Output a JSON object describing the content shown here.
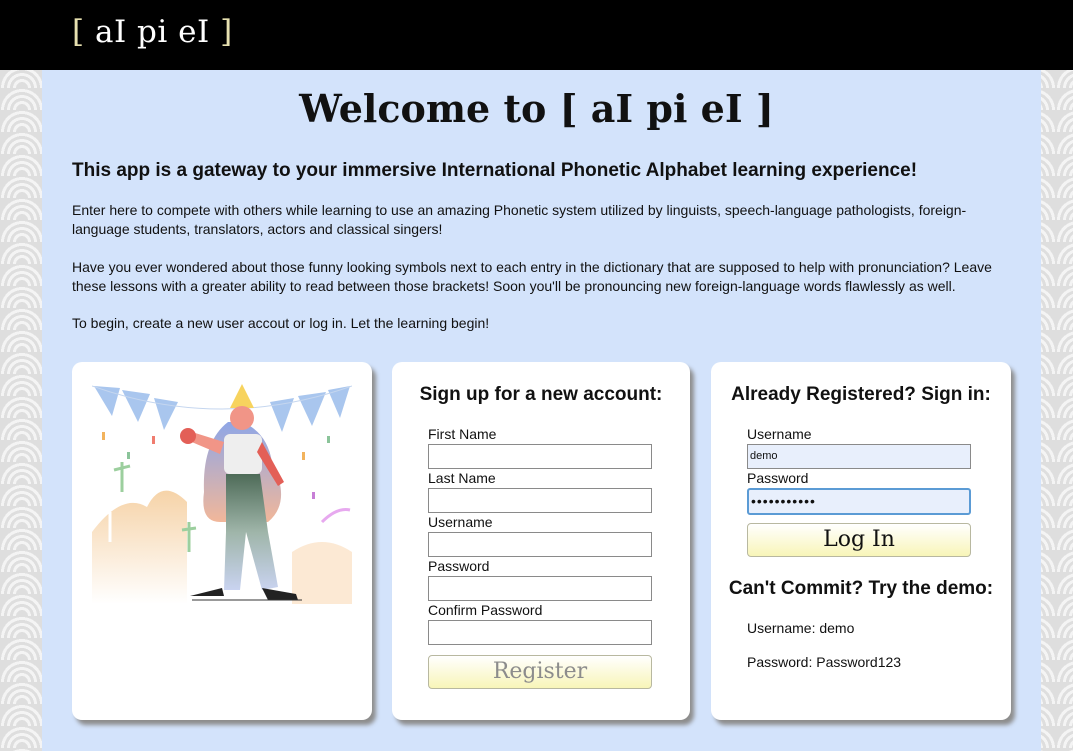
{
  "header": {
    "logo_open": "[",
    "logo_text": " aI pi eI ",
    "logo_close": "]"
  },
  "welcome": {
    "title": "Welcome to [ aI pi eI ]"
  },
  "intro": {
    "heading": "This app is a gateway to your immersive International Phonetic Alphabet learning experience!",
    "p1": "Enter here to compete with others while learning to use an amazing Phonetic system utilized by linguists, speech-language pathologists, foreign-language students, translators, actors and classical singers!",
    "p2": "Have you ever wondered about those funny looking symbols next to each entry in the dictionary that are supposed to help with pronunciation? Leave these lessons with a greater ability to read between those brackets! Soon you'll be pronouncing new foreign-language words flawlessly as well.",
    "p3": "To begin, create a new user accout or log in. Let the learning begin!"
  },
  "signup": {
    "title": "Sign up for a new account:",
    "first_name_label": "First Name",
    "last_name_label": "Last Name",
    "username_label": "Username",
    "password_label": "Password",
    "confirm_label": "Confirm Password",
    "register_label": "Register"
  },
  "login": {
    "title": "Already Registered? Sign in:",
    "username_label": "Username",
    "username_value": "demo",
    "password_label": "Password",
    "password_value": "Password123",
    "login_label": "Log In"
  },
  "demo": {
    "title": "Can't Commit? Try the demo:",
    "username_line": "Username: demo",
    "password_line": "Password: Password123"
  },
  "colors": {
    "header_bg": "#000000",
    "panel_bg": "#d3e3fb",
    "button_gradient_end": "#f8f5b8",
    "focus_ring": "#5b9bd5"
  }
}
